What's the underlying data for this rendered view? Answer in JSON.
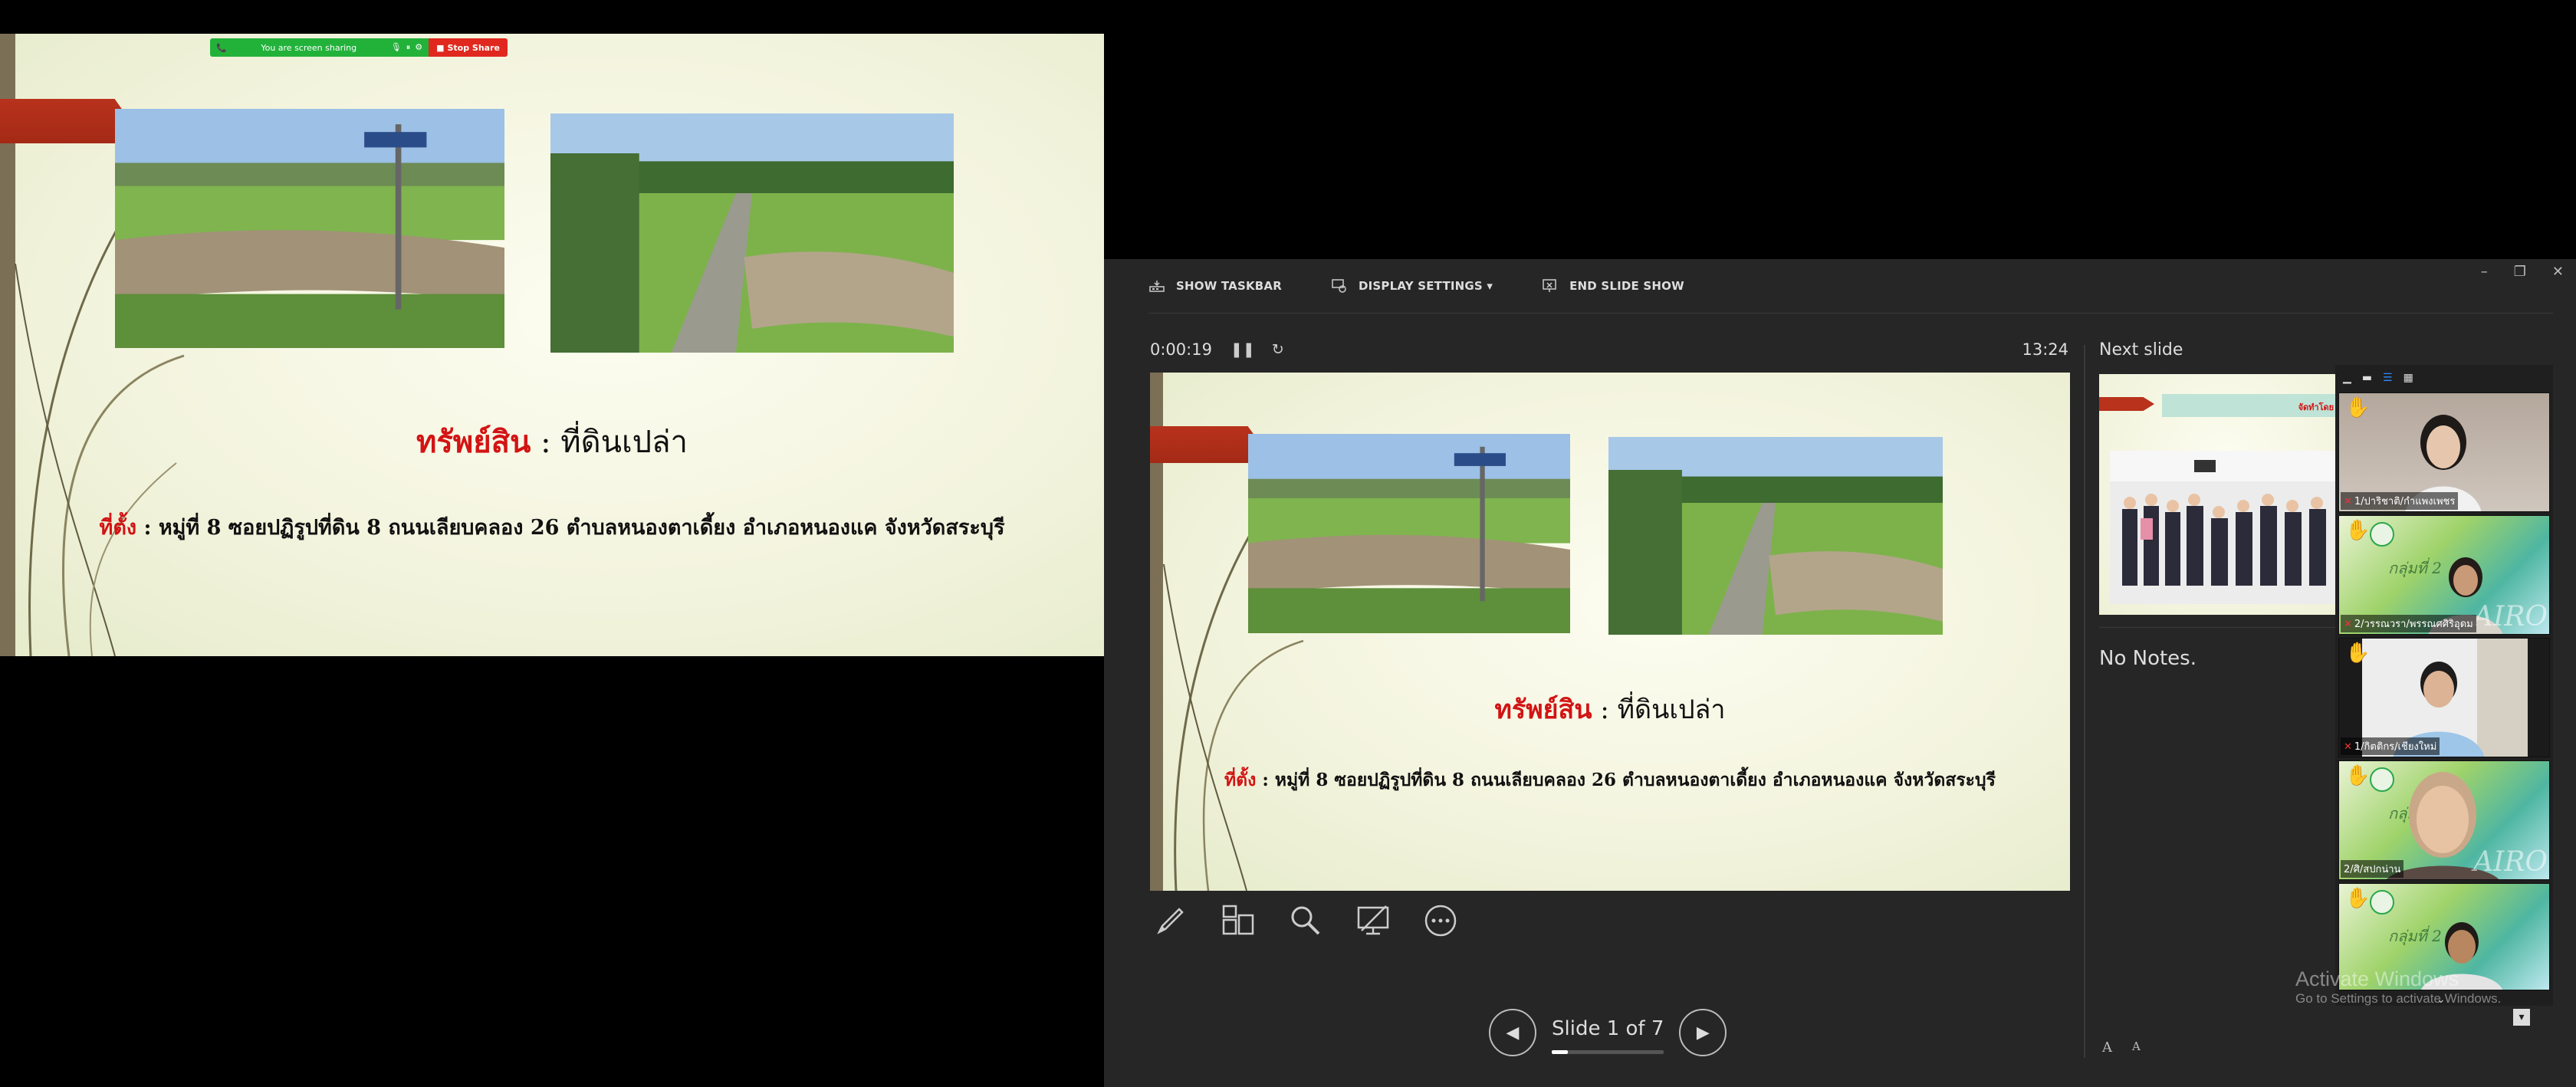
{
  "screen_share": {
    "status_text": "You are screen sharing",
    "stop_label": "Stop Share"
  },
  "slide": {
    "title_red": "ทรัพย์สิน",
    "title_sep": " : ",
    "title_black": "ที่ดินเปล่า",
    "location_label": "ที่ตั้ง",
    "location_text": " : หมู่ที่ 8 ซอยปฏิรูปที่ดิน 8 ถนนเลียบคลอง 26  ตำบลหนองตาเดี้ยง อำเภอหนองแค จังหวัดสระบุรี"
  },
  "presenter": {
    "toolbar": {
      "show_taskbar": "SHOW TASKBAR",
      "display_settings": "DISPLAY SETTINGS ▾",
      "end_slide_show": "END SLIDE SHOW"
    },
    "timer": "0:00:19",
    "clock": "13:24",
    "next_slide_label": "Next slide",
    "next_slide_banner": "จัดทำโดย : ฯ",
    "notes": "No Notes.",
    "slide_counter": "Slide 1 of 7",
    "progress_fraction": 0.1428,
    "font_increase": "A",
    "font_decrease": "A"
  },
  "participants": [
    {
      "name": "1/ปาริชาติ/กำแพงเพชร",
      "has_hand": true
    },
    {
      "name": "2/วรรณวรา/พรรณศศิริอุดม",
      "has_hand": true,
      "thai_title": "กลุ่มที่ 2",
      "watermark": "AIRO"
    },
    {
      "name": "1/กิตติกร/เชียงใหม่",
      "has_hand": true
    },
    {
      "name": "2/ศิ/สปกน่าน",
      "has_hand": true,
      "thai_title": "กลุ่มที่ 2",
      "watermark": "AIRO"
    },
    {
      "name": "",
      "has_hand": true,
      "thai_title": "กลุ่มที่ 2"
    }
  ],
  "windows_notice": {
    "line1": "Activate Windows",
    "line2": "Go to Settings to activate Windows."
  },
  "colors": {
    "accent_red": "#d21414",
    "share_green": "#22b23a",
    "stop_red": "#e0281e",
    "tab_red": "#b8321c"
  }
}
